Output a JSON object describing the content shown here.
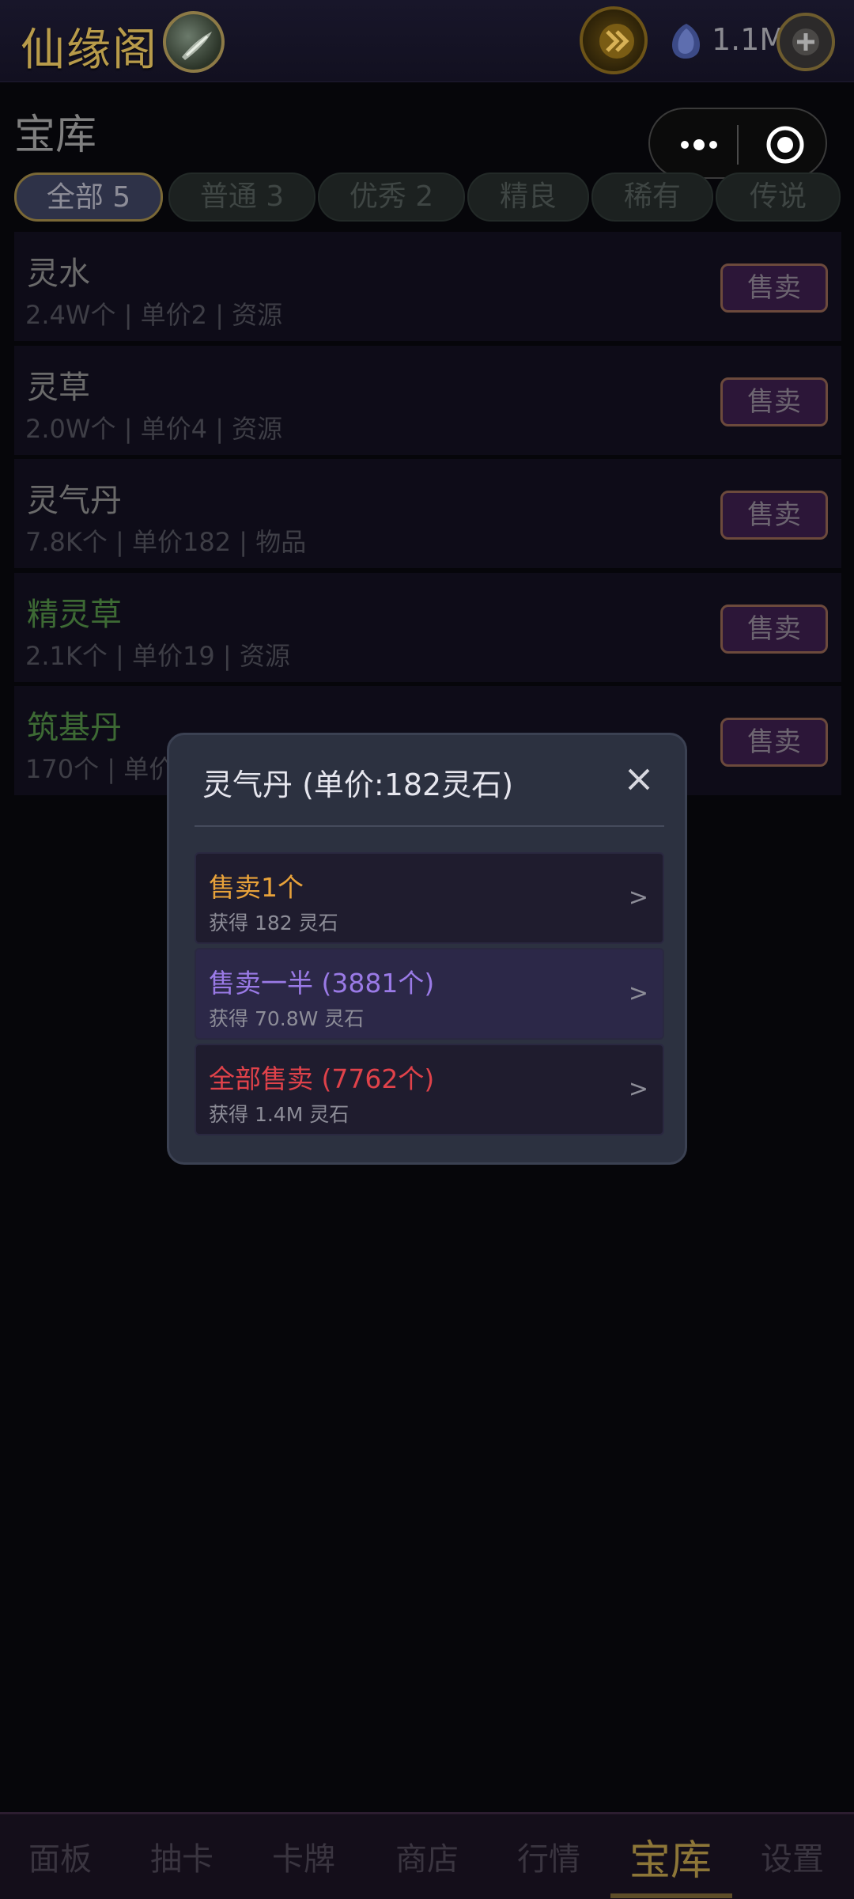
{
  "header": {
    "app_title": "仙缘阁",
    "currency_amount": "1.1M",
    "icons": [
      "logo-icon",
      "fast-forward-icon",
      "spirit-stone-icon",
      "plus-icon"
    ]
  },
  "page": {
    "title": "宝库"
  },
  "tabs": [
    {
      "label": "全部 5",
      "active": true
    },
    {
      "label": "普通 3",
      "active": false
    },
    {
      "label": "优秀 2",
      "active": false
    },
    {
      "label": "精良",
      "active": false
    },
    {
      "label": "稀有",
      "active": false
    },
    {
      "label": "传说",
      "active": false
    }
  ],
  "items": [
    {
      "name": "灵水",
      "info": "2.4W个 | 单价2 | 资源",
      "sell_label": "售卖",
      "color": "#6a6a6a"
    },
    {
      "name": "灵草",
      "info": "2.0W个 | 单价4 | 资源",
      "sell_label": "售卖",
      "color": "#6a6a6a"
    },
    {
      "name": "灵气丹",
      "info": "7.8K个 | 单价182 | 物品",
      "sell_label": "售卖",
      "color": "#6a6a6a"
    },
    {
      "name": "精灵草",
      "info": "2.1K个 | 单价19 | 资源",
      "sell_label": "售卖",
      "color": "#3d6a34"
    },
    {
      "name": "筑基丹",
      "info": "170个 | 单价",
      "sell_label": "售卖",
      "color": "#3d6a34"
    }
  ],
  "dialog": {
    "title": "灵气丹 (单价:182灵石)",
    "options": [
      {
        "title": "售卖1个",
        "subtitle": "获得 182 灵石",
        "color": "#e8a23a"
      },
      {
        "title": "售卖一半 (3881个)",
        "subtitle": "获得 70.8W 灵石",
        "color": "#9a7ae6"
      },
      {
        "title": "全部售卖 (7762个)",
        "subtitle": "获得 1.4M 灵石",
        "color": "#e0424a"
      }
    ],
    "arrow": ">"
  },
  "bottom_nav": [
    {
      "label": "面板",
      "active": false
    },
    {
      "label": "抽卡",
      "active": false
    },
    {
      "label": "卡牌",
      "active": false
    },
    {
      "label": "商店",
      "active": false
    },
    {
      "label": "行情",
      "active": false
    },
    {
      "label": "宝库",
      "active": true
    },
    {
      "label": "设置",
      "active": false
    }
  ]
}
